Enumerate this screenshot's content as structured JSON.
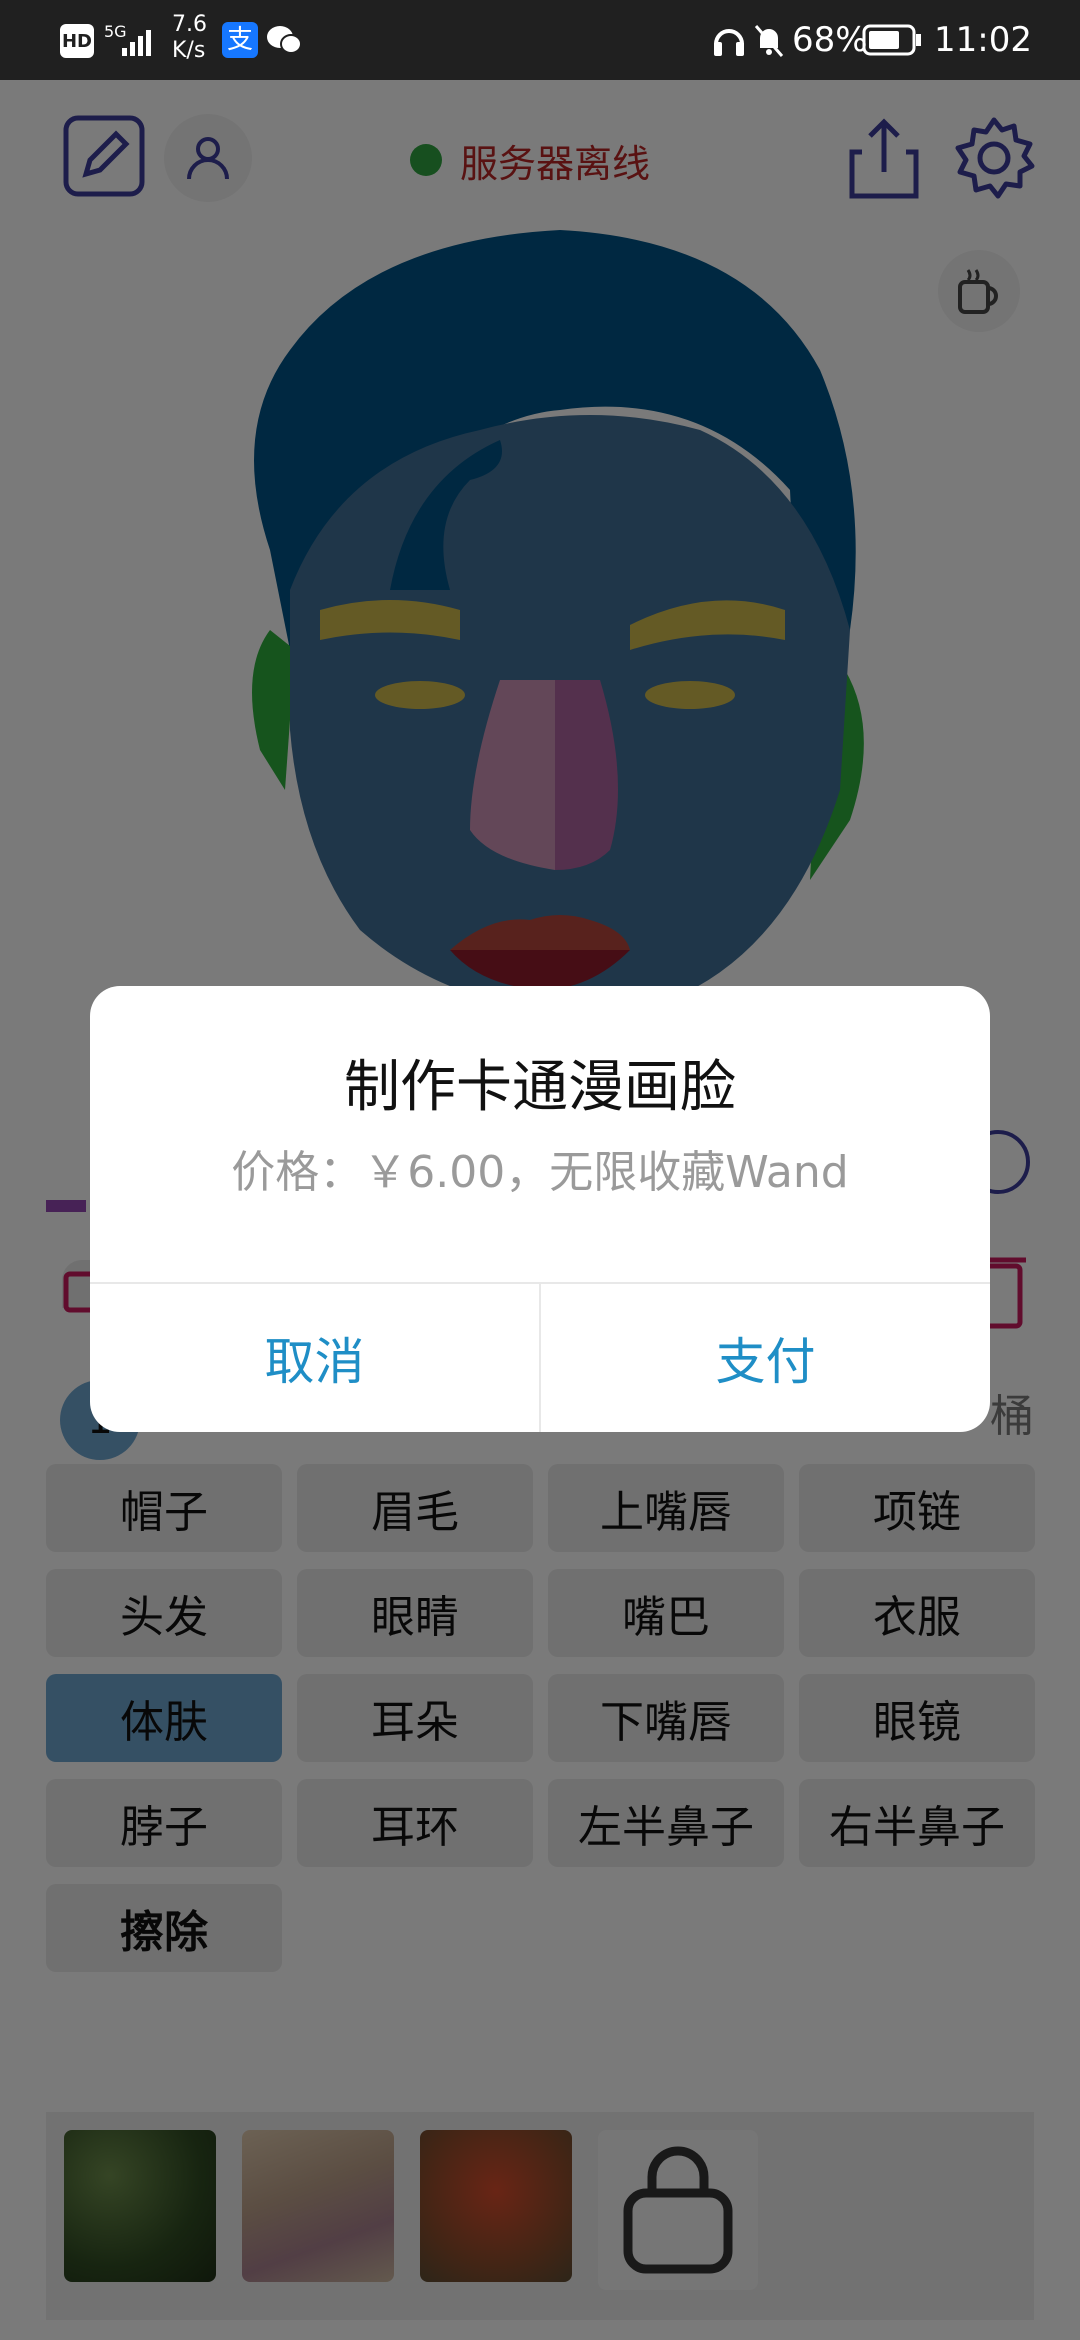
{
  "status_bar": {
    "hd": "HD",
    "network": "5G",
    "speed_value": "7.6",
    "speed_unit": "K/s",
    "battery": "68%",
    "time": "11:02"
  },
  "app_bar": {
    "server_status": "服务器离线",
    "server_status_color": "#2e9e3e"
  },
  "colors": {
    "accent": "#3b3b96",
    "selected_part": "#6aa0c9",
    "dialog_button": "#1f8ec6"
  },
  "obscured": {
    "row_number": "1",
    "bucket_label": "桶"
  },
  "parts": [
    {
      "label": "帽子"
    },
    {
      "label": "眉毛"
    },
    {
      "label": "上嘴唇"
    },
    {
      "label": "项链"
    },
    {
      "label": "头发"
    },
    {
      "label": "眼睛"
    },
    {
      "label": "嘴巴"
    },
    {
      "label": "衣服"
    },
    {
      "label": "体肤",
      "selected": true
    },
    {
      "label": "耳朵"
    },
    {
      "label": "下嘴唇"
    },
    {
      "label": "眼镜"
    },
    {
      "label": "脖子"
    },
    {
      "label": "耳环"
    },
    {
      "label": "左半鼻子"
    },
    {
      "label": "右半鼻子"
    },
    {
      "label": "擦除"
    }
  ],
  "dialog": {
    "title": "制作卡通漫画脸",
    "message": "价格：￥6.00，无限收藏Wand",
    "cancel": "取消",
    "pay": "支付"
  }
}
